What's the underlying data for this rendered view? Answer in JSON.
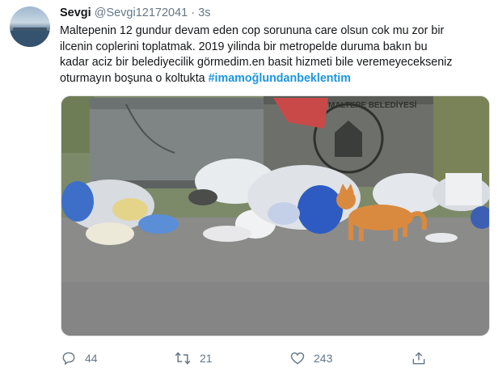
{
  "tweet": {
    "author_name": "Sevgi",
    "author_handle": "@Sevgi12172041",
    "separator": "·",
    "time": "3s",
    "text_lines": [
      "Maltepenin 12 gundur devam eden cop sorununa care olsun cok mu zor bir",
      "ilcenin coplerini toplatmak. 2019 yilinda bir metropelde duruma bakın bu",
      "kadar aciz bir belediyecilik görmedim.en basit hizmeti bile veremeyecekseniz",
      "oturmayın boşuna o koltukta "
    ],
    "hashtag": "#imamoğlundanbeklentim",
    "media": {
      "sign_text": "MALTEPE BELEDİYESİ"
    },
    "actions": {
      "reply": {
        "icon": "reply-icon",
        "count": "44"
      },
      "retweet": {
        "icon": "retweet-icon",
        "count": "21"
      },
      "like": {
        "icon": "heart-icon",
        "count": "243"
      },
      "share": {
        "icon": "share-icon"
      }
    }
  },
  "colors": {
    "text": "#14171a",
    "secondary": "#657786",
    "link": "#1b95e0",
    "background": "#ffffff"
  }
}
